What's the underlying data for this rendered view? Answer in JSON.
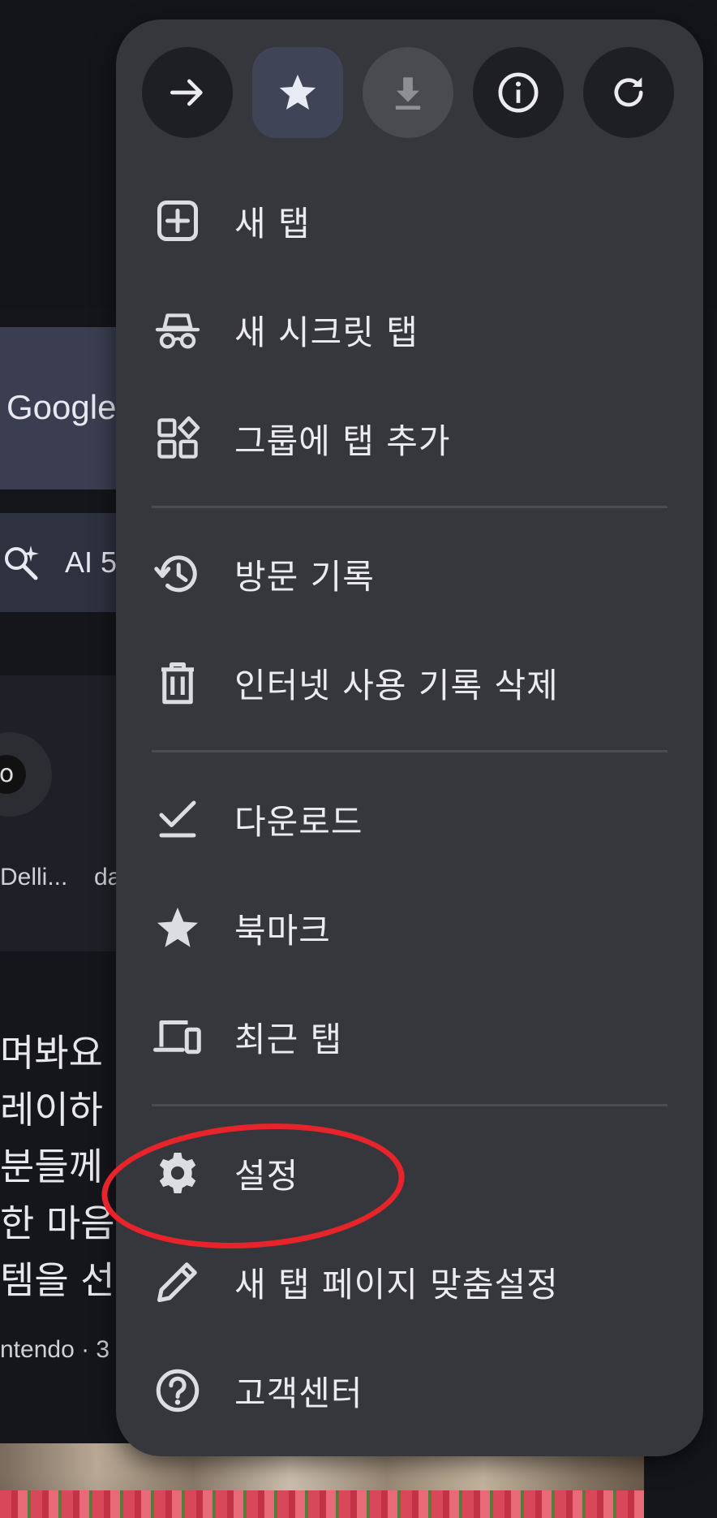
{
  "background": {
    "search_text": "Google",
    "ai_label": "AI 5",
    "shortcuts": [
      "Delli...",
      "da"
    ],
    "article_lines": [
      "며봐요 등",
      "레이하",
      "분들께",
      "한 마음",
      "템을 선"
    ],
    "article_meta": "ntendo · 3",
    "circle_glyph": "o"
  },
  "toolbar": {
    "forward": "forward-icon",
    "bookmark": "star-icon",
    "download": "download-icon",
    "info": "info-icon",
    "reload": "reload-icon"
  },
  "menu": {
    "items": [
      {
        "label": "새 탭",
        "icon": "add-box-icon"
      },
      {
        "label": "새 시크릿 탭",
        "icon": "incognito-icon"
      },
      {
        "label": "그룹에 탭 추가",
        "icon": "tab-group-icon"
      },
      {
        "label": "방문 기록",
        "icon": "history-icon"
      },
      {
        "label": "인터넷 사용 기록 삭제",
        "icon": "trash-icon"
      },
      {
        "label": "다운로드",
        "icon": "download-done-icon"
      },
      {
        "label": "북마크",
        "icon": "star-icon"
      },
      {
        "label": "최근 탭",
        "icon": "devices-icon"
      },
      {
        "label": "설정",
        "icon": "gear-icon"
      },
      {
        "label": "새 탭 페이지 맞춤설정",
        "icon": "pencil-icon"
      },
      {
        "label": "고객센터",
        "icon": "help-icon"
      }
    ]
  },
  "colors": {
    "menu_bg": "#36373d",
    "highlight": "#e8242b",
    "active_button": "#3f4456"
  }
}
